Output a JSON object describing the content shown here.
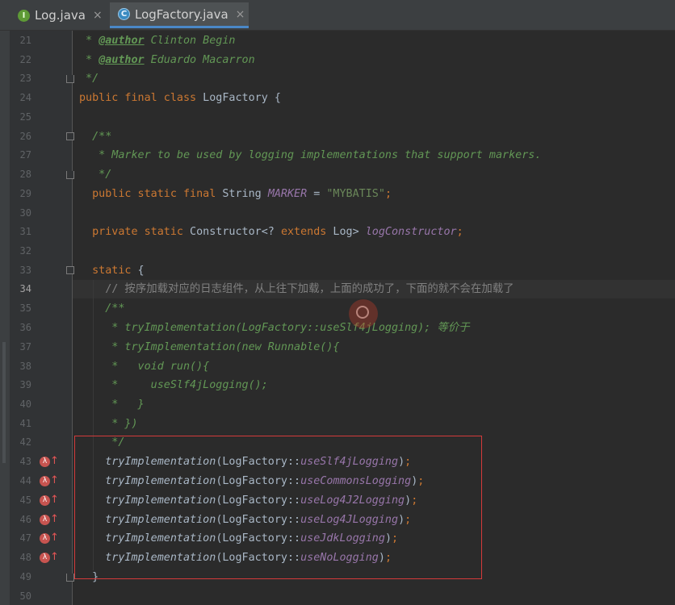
{
  "tabs": [
    {
      "label": "Log.java",
      "icon_letter": "I",
      "icon": "interface-icon",
      "active": false
    },
    {
      "label": "LogFactory.java",
      "icon_letter": "C",
      "icon": "class-icon",
      "active": true
    }
  ],
  "tab_close_glyph": "×",
  "colors": {
    "keyword": "#cc7832",
    "doc_comment": "#629755",
    "line_comment": "#808080",
    "string": "#6a8759",
    "field": "#9876aa",
    "default_text": "#a9b7c6",
    "highlight_box": "#d43a3a"
  },
  "current_line": "34",
  "lines": {
    "n21": "21",
    "n22": "22",
    "n23": "23",
    "n24": "24",
    "n25": "25",
    "n26": "26",
    "n27": "27",
    "n28": "28",
    "n29": "29",
    "n30": "30",
    "n31": "31",
    "n32": "32",
    "n33": "33",
    "n34": "34",
    "n35": "35",
    "n36": "36",
    "n37": "37",
    "n38": "38",
    "n39": "39",
    "n40": "40",
    "n41": "41",
    "n42": "42",
    "n43": "43",
    "n44": "44",
    "n45": "45",
    "n46": "46",
    "n47": "47",
    "n48": "48",
    "n49": "49",
    "n50": "50"
  },
  "code": {
    "l21_star": " * ",
    "l21_tag": "@author",
    "l21_name": " Clinton Begin",
    "l22_star": " * ",
    "l22_tag": "@author",
    "l22_name": " Eduardo Macarron",
    "l23": " */",
    "l24_kw": "public final class",
    "l24_rest": " LogFactory {",
    "l26": "  /**",
    "l27": "   * Marker to be used by logging implementations that support markers.",
    "l28": "   */",
    "l29_kw": "  public static final",
    "l29_type": " String ",
    "l29_field": "MARKER",
    "l29_eq": " = ",
    "l29_str": "\"MYBATIS\"",
    "l29_semi": ";",
    "l31_kw": "  private static",
    "l31_type": " Constructor<? ",
    "l31_ext": "extends",
    "l31_log": " Log> ",
    "l31_field": "logConstructor",
    "l31_semi": ";",
    "l33_kw": "  static",
    "l33_rest": " {",
    "l34": "    // 按序加载对应的日志组件，从上往下加载，上面的成功了，下面的就不会在加载了",
    "l35": "    /**",
    "l36": "     * tryImplementation(LogFactory::useSlf4jLogging); 等价于",
    "l37": "     * tryImplementation(new Runnable(){",
    "l38": "     *   void run(){",
    "l39": "     *     useSlf4jLogging();",
    "l40": "     *   }",
    "l41": "     * })",
    "l42": "     */",
    "l43_call": "    tryImplementation",
    "l43_open": "(LogFactory::",
    "l43_m": "useSlf4jLogging",
    "l43_close": ")",
    "l43_semi": ";",
    "l44_call": "    tryImplementation",
    "l44_open": "(LogFactory::",
    "l44_m": "useCommonsLogging",
    "l44_close": ")",
    "l44_semi": ";",
    "l45_call": "    tryImplementation",
    "l45_open": "(LogFactory::",
    "l45_m": "useLog4J2Logging",
    "l45_close": ")",
    "l45_semi": ";",
    "l46_call": "    tryImplementation",
    "l46_open": "(LogFactory::",
    "l46_m": "useLog4JLogging",
    "l46_close": ")",
    "l46_semi": ";",
    "l47_call": "    tryImplementation",
    "l47_open": "(LogFactory::",
    "l47_m": "useJdkLogging",
    "l47_close": ")",
    "l47_semi": ";",
    "l48_call": "    tryImplementation",
    "l48_open": "(LogFactory::",
    "l48_m": "useNoLogging",
    "l48_close": ")",
    "l48_semi": ";",
    "l49": "  }"
  },
  "gutter_icons": {
    "lambda_glyph": "λ",
    "override_glyph": "↑"
  }
}
